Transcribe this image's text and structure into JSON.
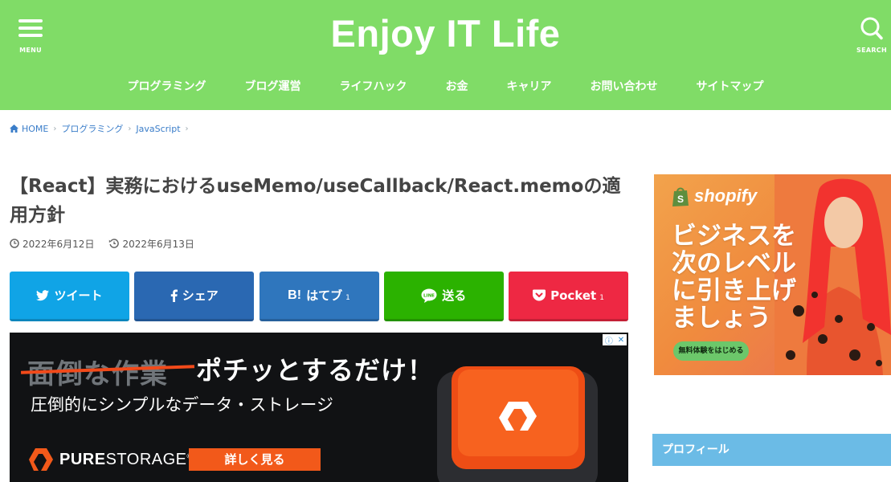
{
  "header": {
    "site_title": "Enjoy IT Life",
    "menu_label": "MENU",
    "search_label": "SEARCH",
    "brand_color": "#80dc67",
    "nav": [
      {
        "label": "プログラミング"
      },
      {
        "label": "ブログ運営"
      },
      {
        "label": "ライフハック"
      },
      {
        "label": "お金"
      },
      {
        "label": "キャリア"
      },
      {
        "label": "お問い合わせ"
      },
      {
        "label": "サイトマップ"
      }
    ]
  },
  "breadcrumb": {
    "items": [
      {
        "label": "HOME",
        "icon": "home-icon"
      },
      {
        "label": "プログラミング"
      },
      {
        "label": "JavaScript"
      }
    ]
  },
  "article": {
    "title": "【React】実務におけるuseMemo/useCallback/React.memoの適用方針",
    "published": "2022年6月12日",
    "updated": "2022年6月13日"
  },
  "share": {
    "buttons": [
      {
        "label": "ツイート",
        "count": "",
        "icon": "twitter-bird-icon",
        "color": "#10a4e6"
      },
      {
        "label": "シェア",
        "count": "",
        "icon": "facebook-f-icon",
        "color": "#2a68b2"
      },
      {
        "label": "はてブ",
        "count": "1",
        "icon": "hatena-bookmark-icon",
        "color": "#2f76bd"
      },
      {
        "label": "送る",
        "count": "",
        "icon": "line-icon",
        "color": "#2bb200"
      },
      {
        "label": "Pocket",
        "count": "1",
        "icon": "pocket-icon",
        "color": "#ee2843"
      }
    ]
  },
  "ad_banner": {
    "struck_text": "面倒な作業",
    "headline": "ポチッとするだけ！",
    "subline": "圧倒的にシンプルなデータ・ストレージ",
    "brand_bold": "PURE",
    "brand_rest": "STORAGE",
    "brand_mark": "®",
    "cta": "詳しく見る",
    "accent": "#f2591a"
  },
  "sidebar": {
    "ad": {
      "brand": "shopify",
      "copy_lines": [
        "ビジネスを",
        "次のレベル",
        "に引き上げ",
        "ましょう"
      ],
      "cta": "無料体験をはじめる"
    },
    "profile_heading": "プロフィール",
    "profile_color": "#6bbbe6"
  }
}
